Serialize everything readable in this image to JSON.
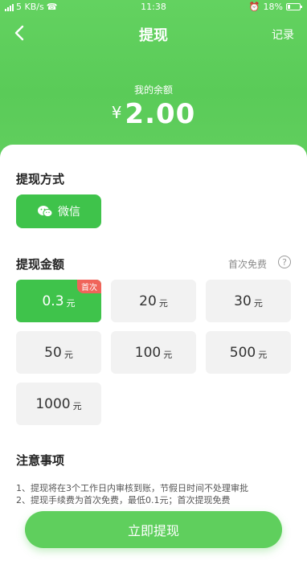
{
  "status_bar": {
    "network": "5 KB/s",
    "time": "11:38",
    "battery": "18%"
  },
  "nav": {
    "title": "提现",
    "record_label": "记录",
    "back_icon": "chevron-left-icon"
  },
  "balance": {
    "label": "我的余额",
    "currency": "¥",
    "amount": "2.00"
  },
  "method": {
    "title": "提现方式",
    "option_label": "微信",
    "option_icon": "wechat-icon"
  },
  "amount_section": {
    "title": "提现金额",
    "first_free_label": "首次免费",
    "unit": "元",
    "first_badge": "首次",
    "options": [
      "0.3",
      "20",
      "30",
      "50",
      "100",
      "500",
      "1000"
    ],
    "selected": "0.3"
  },
  "notice": {
    "title": "注意事项",
    "lines": [
      "1、提现将在3个工作日内审核到账，节假日时间不处理审批",
      "2、提现手续费为首次免费，最低0.1元；首次提现免费"
    ]
  },
  "submit_label": "立即提现",
  "colors": {
    "brand_green": "#3fc34b",
    "header_green": "#5acb58",
    "badge_red": "#f0645a"
  }
}
